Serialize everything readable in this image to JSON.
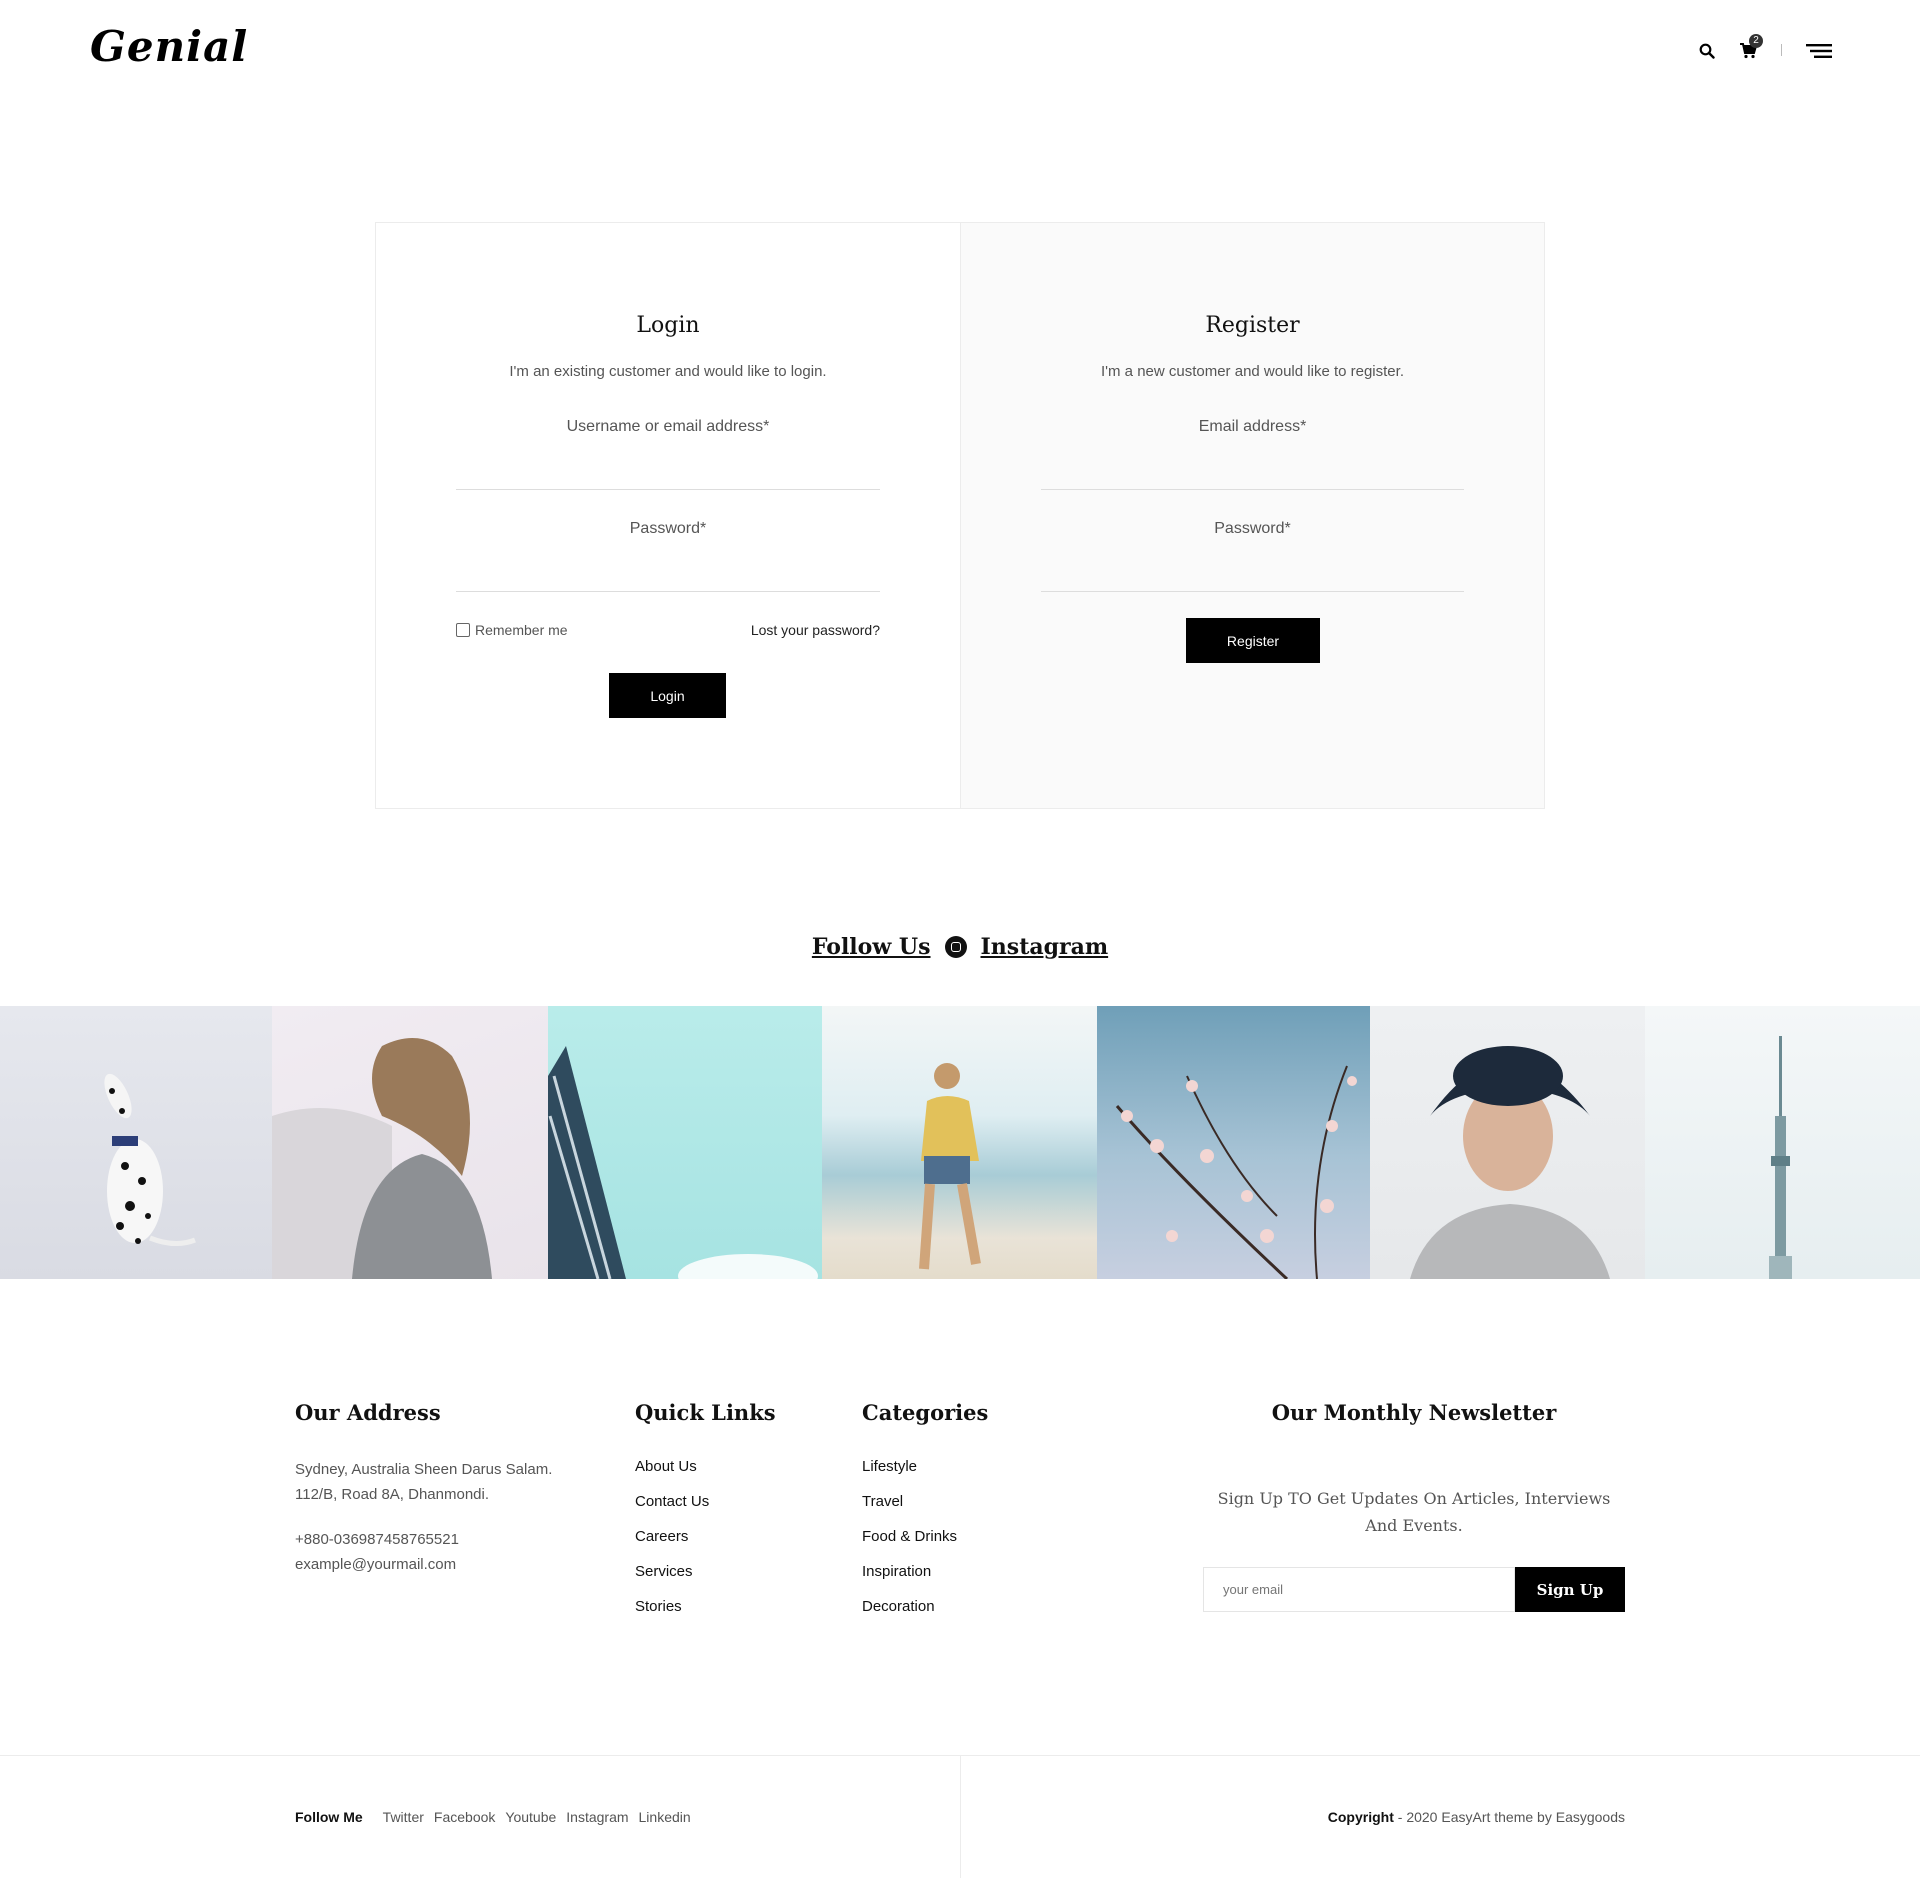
{
  "header": {
    "logo": "Genial",
    "cart_count": "2"
  },
  "login": {
    "title": "Login",
    "subtitle": "I'm an existing customer and would like to login.",
    "username_label": "Username or email address*",
    "password_label": "Password*",
    "remember_label": "Remember me",
    "lost_password": "Lost your password?",
    "button": "Login"
  },
  "register": {
    "title": "Register",
    "subtitle": "I'm a new customer and would like to register.",
    "email_label": "Email address*",
    "password_label": "Password*",
    "button": "Register"
  },
  "follow": {
    "left": "Follow Us",
    "right": "Instagram"
  },
  "footer": {
    "address": {
      "title": "Our Address",
      "line1": "Sydney, Australia Sheen Darus Salam.",
      "line2": "112/B, Road 8A, Dhanmondi.",
      "phone": "+880-036987458765521",
      "email": "example@yourmail.com"
    },
    "quick_links": {
      "title": "Quick Links",
      "items": [
        "About Us",
        "Contact Us",
        "Careers",
        "Services",
        "Stories"
      ]
    },
    "categories": {
      "title": "Categories",
      "items": [
        "Lifestyle",
        "Travel",
        "Food & Drinks",
        "Inspiration",
        "Decoration"
      ]
    },
    "newsletter": {
      "title": "Our Monthly Newsletter",
      "subtitle": "Sign Up TO Get Updates On Articles, Interviews And Events.",
      "placeholder": "your email",
      "button": "Sign Up"
    }
  },
  "bottom": {
    "follow_label": "Follow Me",
    "social": [
      "Twitter",
      "Facebook",
      "Youtube",
      "Instagram",
      "Linkedin"
    ],
    "copyright_bold": "Copyright",
    "copyright_rest": " - 2020 EasyArt theme by Easygoods"
  }
}
